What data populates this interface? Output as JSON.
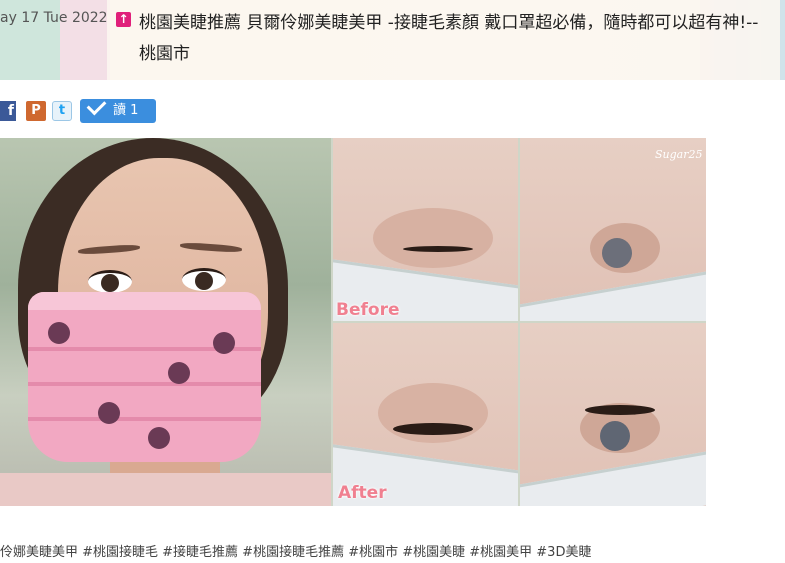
{
  "post": {
    "date": "ay 17 Tue 2022",
    "title_icon": "pin-icon",
    "title": "桃園美睫推薦 貝爾伶娜美睫美甲 -接睫毛素顏 戴口罩超必備，隨時都可以超有神!--桃園市"
  },
  "share": {
    "facebook_glyph": "f",
    "plurk_glyph": "P",
    "twitter_glyph": "t",
    "read_label": "讀 1"
  },
  "photo": {
    "before_label": "Before",
    "after_label": "After",
    "watermark": "Sugar25"
  },
  "tags_text": "伶娜美睫美甲 #桃園接睫毛 #接睫毛推薦 #桃園接睫毛推薦 #桃園市 #桃園美睫 #桃園美甲 #3D美睫",
  "colors": {
    "title_icon": "#e0207a",
    "read_button": "#3b8ede",
    "label_pink": "#f08090"
  }
}
